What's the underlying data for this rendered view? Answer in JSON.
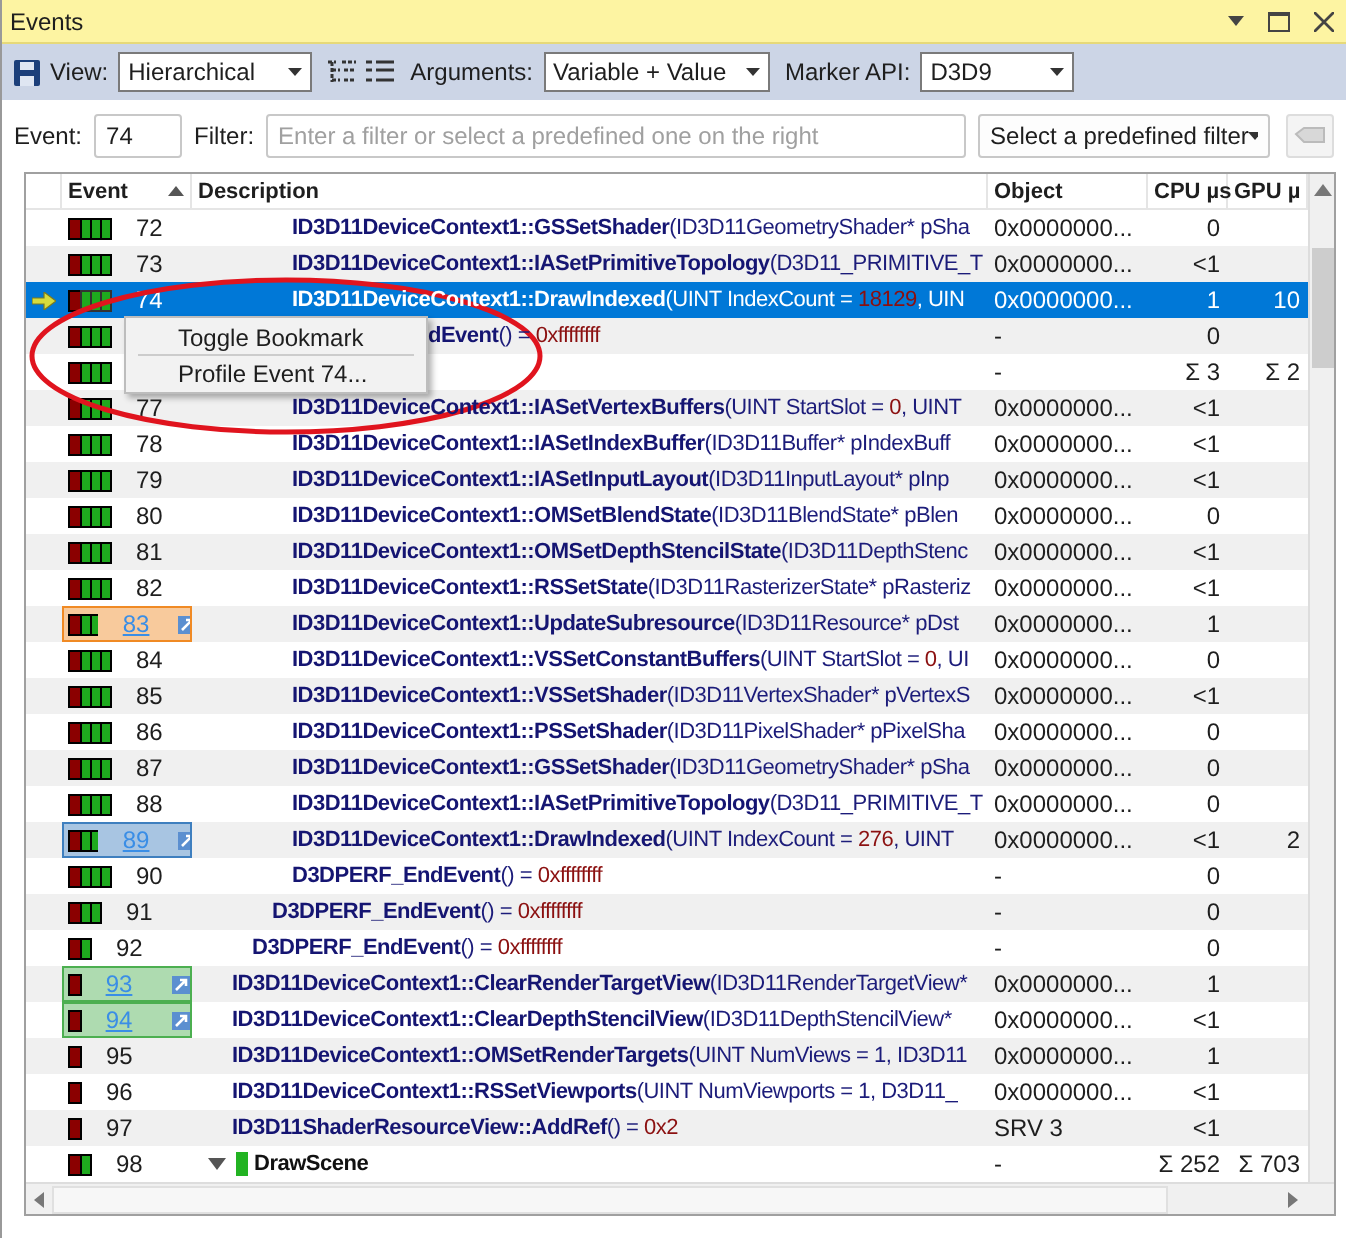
{
  "window": {
    "title": "Events"
  },
  "toolbar": {
    "view_label": "View:",
    "view": "Hierarchical",
    "arguments_label": "Arguments:",
    "arguments": "Variable + Value",
    "marker_label": "Marker API:",
    "marker": "D3D9"
  },
  "filter_bar": {
    "event_label": "Event:",
    "event": "74",
    "filter_label": "Filter:",
    "placeholder": "Enter a filter or select a predefined one on the right",
    "predefined": "Select a predefined filter"
  },
  "table": {
    "columns": [
      {
        "label": "Event",
        "sorted": true
      },
      {
        "label": "Description",
        "sorted": false
      },
      {
        "label": "Object",
        "sorted": false
      },
      {
        "label": "CPU µs",
        "sorted": false
      },
      {
        "label": "GPU µ",
        "sorted": false
      }
    ],
    "rows": [
      {
        "children": [
          {
            "children": [
              {
                "children": [
                  {
                    "event": "72",
                    "selected": false,
                    "link": false,
                    "description": [
                      {
                        "kind": "fn",
                        "text": "ID3D11DeviceContext1::GSSetShader"
                      },
                      {
                        "kind": "arg",
                        "text": "(ID3D11GeometryShader* pSha"
                      }
                    ],
                    "object": "0x0000000...",
                    "cpu": "0"
                  },
                  {
                    "event": "73",
                    "selected": false,
                    "link": false,
                    "description": [
                      {
                        "kind": "fn",
                        "text": "ID3D11DeviceContext1::IASetPrimitiveTopology"
                      },
                      {
                        "kind": "arg",
                        "text": "(D3D11_PRIMITIVE_T"
                      }
                    ],
                    "object": "0x0000000...",
                    "cpu": "<1"
                  },
                  {
                    "event": "74",
                    "selected": true,
                    "link": false,
                    "description": [
                      {
                        "kind": "fn",
                        "text": "ID3D11DeviceContext1::DrawIndexed"
                      },
                      {
                        "kind": "arg",
                        "text": "(UINT IndexCount = "
                      },
                      {
                        "kind": "val",
                        "text": "18129"
                      },
                      {
                        "kind": "arg",
                        "text": ", UIN"
                      }
                    ],
                    "object": "0x0000000...",
                    "cpu": "1",
                    "gpu": "10"
                  },
                  {
                    "selected": false,
                    "description": [
                      {
                        "kind": "fn",
                        "text": "dEvent"
                      },
                      {
                        "kind": "arg",
                        "text": "() = "
                      },
                      {
                        "kind": "val",
                        "text": "0xffffffff"
                      }
                    ],
                    "object": "-",
                    "cpu": "0"
                  }
                ]
              },
              {
                "selected": false,
                "object": "-",
                "cpu": "Σ 3",
                "gpu": "Σ 2",
                "children": [
                  {
                    "event": "77",
                    "selected": false,
                    "link": false,
                    "description": [
                      {
                        "kind": "fn",
                        "text": "ID3D11DeviceContext1::IASetVertexBuffers"
                      },
                      {
                        "kind": "arg",
                        "text": "(UINT StartSlot = "
                      },
                      {
                        "kind": "val",
                        "text": "0"
                      },
                      {
                        "kind": "arg",
                        "text": ", UINT"
                      }
                    ],
                    "object": "0x0000000...",
                    "cpu": "<1"
                  },
                  {
                    "event": "78",
                    "selected": false,
                    "link": false,
                    "description": [
                      {
                        "kind": "fn",
                        "text": "ID3D11DeviceContext1::IASetIndexBuffer"
                      },
                      {
                        "kind": "arg",
                        "text": "(ID3D11Buffer* pIndexBuff"
                      }
                    ],
                    "object": "0x0000000...",
                    "cpu": "<1"
                  },
                  {
                    "event": "79",
                    "selected": false,
                    "link": false,
                    "description": [
                      {
                        "kind": "fn",
                        "text": "ID3D11DeviceContext1::IASetInputLayout"
                      },
                      {
                        "kind": "arg",
                        "text": "(ID3D11InputLayout* pInp"
                      }
                    ],
                    "object": "0x0000000...",
                    "cpu": "<1"
                  },
                  {
                    "event": "80",
                    "selected": false,
                    "link": false,
                    "description": [
                      {
                        "kind": "fn",
                        "text": "ID3D11DeviceContext1::OMSetBlendState"
                      },
                      {
                        "kind": "arg",
                        "text": "(ID3D11BlendState* pBlen"
                      }
                    ],
                    "object": "0x0000000...",
                    "cpu": "0"
                  },
                  {
                    "event": "81",
                    "selected": false,
                    "link": false,
                    "description": [
                      {
                        "kind": "fn",
                        "text": "ID3D11DeviceContext1::OMSetDepthStencilState"
                      },
                      {
                        "kind": "arg",
                        "text": "(ID3D11DepthStenc"
                      }
                    ],
                    "object": "0x0000000...",
                    "cpu": "<1"
                  },
                  {
                    "event": "82",
                    "selected": false,
                    "link": false,
                    "description": [
                      {
                        "kind": "fn",
                        "text": "ID3D11DeviceContext1::RSSetState"
                      },
                      {
                        "kind": "arg",
                        "text": "(ID3D11RasterizerState* pRasteriz"
                      }
                    ],
                    "object": "0x0000000...",
                    "cpu": "<1"
                  },
                  {
                    "event": "83",
                    "selected": false,
                    "link": true,
                    "color": "#f08a24",
                    "description": [
                      {
                        "kind": "fn",
                        "text": "ID3D11DeviceContext1::UpdateSubresource"
                      },
                      {
                        "kind": "arg",
                        "text": "(ID3D11Resource* pDst"
                      }
                    ],
                    "object": "0x0000000...",
                    "cpu": "1"
                  },
                  {
                    "event": "84",
                    "selected": false,
                    "link": false,
                    "description": [
                      {
                        "kind": "fn",
                        "text": "ID3D11DeviceContext1::VSSetConstantBuffers"
                      },
                      {
                        "kind": "arg",
                        "text": "(UINT StartSlot = "
                      },
                      {
                        "kind": "val",
                        "text": "0"
                      },
                      {
                        "kind": "arg",
                        "text": ", UI"
                      }
                    ],
                    "object": "0x0000000...",
                    "cpu": "0"
                  },
                  {
                    "event": "85",
                    "selected": false,
                    "link": false,
                    "description": [
                      {
                        "kind": "fn",
                        "text": "ID3D11DeviceContext1::VSSetShader"
                      },
                      {
                        "kind": "arg",
                        "text": "(ID3D11VertexShader* pVertexS"
                      }
                    ],
                    "object": "0x0000000...",
                    "cpu": "<1"
                  },
                  {
                    "event": "86",
                    "selected": false,
                    "link": false,
                    "description": [
                      {
                        "kind": "fn",
                        "text": "ID3D11DeviceContext1::PSSetShader"
                      },
                      {
                        "kind": "arg",
                        "text": "(ID3D11PixelShader* pPixelSha"
                      }
                    ],
                    "object": "0x0000000...",
                    "cpu": "0"
                  },
                  {
                    "event": "87",
                    "selected": false,
                    "link": false,
                    "description": [
                      {
                        "kind": "fn",
                        "text": "ID3D11DeviceContext1::GSSetShader"
                      },
                      {
                        "kind": "arg",
                        "text": "(ID3D11GeometryShader* pSha"
                      }
                    ],
                    "object": "0x0000000...",
                    "cpu": "0"
                  },
                  {
                    "event": "88",
                    "selected": false,
                    "link": false,
                    "description": [
                      {
                        "kind": "fn",
                        "text": "ID3D11DeviceContext1::IASetPrimitiveTopology"
                      },
                      {
                        "kind": "arg",
                        "text": "(D3D11_PRIMITIVE_T"
                      }
                    ],
                    "object": "0x0000000...",
                    "cpu": "0"
                  },
                  {
                    "event": "89",
                    "selected": false,
                    "link": true,
                    "color": "#3e7fbf",
                    "description": [
                      {
                        "kind": "fn",
                        "text": "ID3D11DeviceContext1::DrawIndexed"
                      },
                      {
                        "kind": "arg",
                        "text": "(UINT IndexCount = "
                      },
                      {
                        "kind": "val",
                        "text": "276"
                      },
                      {
                        "kind": "arg",
                        "text": ", UINT"
                      }
                    ],
                    "object": "0x0000000...",
                    "cpu": "<1",
                    "gpu": "2"
                  },
                  {
                    "event": "90",
                    "selected": false,
                    "link": false,
                    "description": [
                      {
                        "kind": "fn",
                        "text": "D3DPERF_EndEvent"
                      },
                      {
                        "kind": "arg",
                        "text": "() = "
                      },
                      {
                        "kind": "val",
                        "text": "0xffffffff"
                      }
                    ],
                    "object": "-",
                    "cpu": "0"
                  }
                ]
              },
              {
                "event": "91",
                "selected": false,
                "link": false,
                "description": [
                  {
                    "kind": "fn",
                    "text": "D3DPERF_EndEvent"
                  },
                  {
                    "kind": "arg",
                    "text": "() = "
                  },
                  {
                    "kind": "val",
                    "text": "0xffffffff"
                  }
                ],
                "object": "-",
                "cpu": "0"
              }
            ]
          },
          {
            "event": "92",
            "selected": false,
            "link": false,
            "description": [
              {
                "kind": "fn",
                "text": "D3DPERF_EndEvent"
              },
              {
                "kind": "arg",
                "text": "() = "
              },
              {
                "kind": "val",
                "text": "0xffffffff"
              }
            ],
            "object": "-",
            "cpu": "0"
          }
        ]
      },
      {
        "event": "93",
        "selected": false,
        "link": true,
        "color": "#4caf50",
        "description": [
          {
            "kind": "fn",
            "text": "ID3D11DeviceContext1::ClearRenderTargetView"
          },
          {
            "kind": "arg",
            "text": "(ID3D11RenderTargetView*"
          }
        ],
        "object": "0x0000000...",
        "cpu": "1"
      },
      {
        "event": "94",
        "selected": false,
        "link": true,
        "color": "#4caf50",
        "description": [
          {
            "kind": "fn",
            "text": "ID3D11DeviceContext1::ClearDepthStencilView"
          },
          {
            "kind": "arg",
            "text": "(ID3D11DepthStencilView*"
          }
        ],
        "object": "0x0000000...",
        "cpu": "<1"
      },
      {
        "event": "95",
        "selected": false,
        "link": false,
        "description": [
          {
            "kind": "fn",
            "text": "ID3D11DeviceContext1::OMSetRenderTargets"
          },
          {
            "kind": "arg",
            "text": "(UINT NumViews = 1, ID3D11"
          }
        ],
        "object": "0x0000000...",
        "cpu": "1"
      },
      {
        "event": "96",
        "selected": false,
        "link": false,
        "description": [
          {
            "kind": "fn",
            "text": "ID3D11DeviceContext1::RSSetViewports"
          },
          {
            "kind": "arg",
            "text": "(UINT NumViewports = 1, D3D11_"
          }
        ],
        "object": "0x0000000...",
        "cpu": "<1"
      },
      {
        "event": "97",
        "selected": false,
        "link": false,
        "description": [
          {
            "kind": "fn",
            "text": "ID3D11ShaderResourceView::AddRef"
          },
          {
            "kind": "arg",
            "text": "() = "
          },
          {
            "kind": "val",
            "text": "0x2"
          }
        ],
        "object": "SRV 3",
        "cpu": "<1"
      },
      {
        "event": "98",
        "selected": false,
        "link": false,
        "expanded": true,
        "marker": {
          "color": "#22b322"
        },
        "description": [
          {
            "kind": "marker",
            "text": "DrawScene"
          }
        ],
        "object": "-",
        "cpu": "Σ 252",
        "gpu": "Σ 703"
      }
    ]
  },
  "context_menu": {
    "items": [
      {
        "label": "Toggle Bookmark"
      },
      {
        "label": "Profile Event 74..."
      }
    ]
  },
  "annotation": {
    "kind": "ellipse",
    "color": "#e0141e"
  }
}
